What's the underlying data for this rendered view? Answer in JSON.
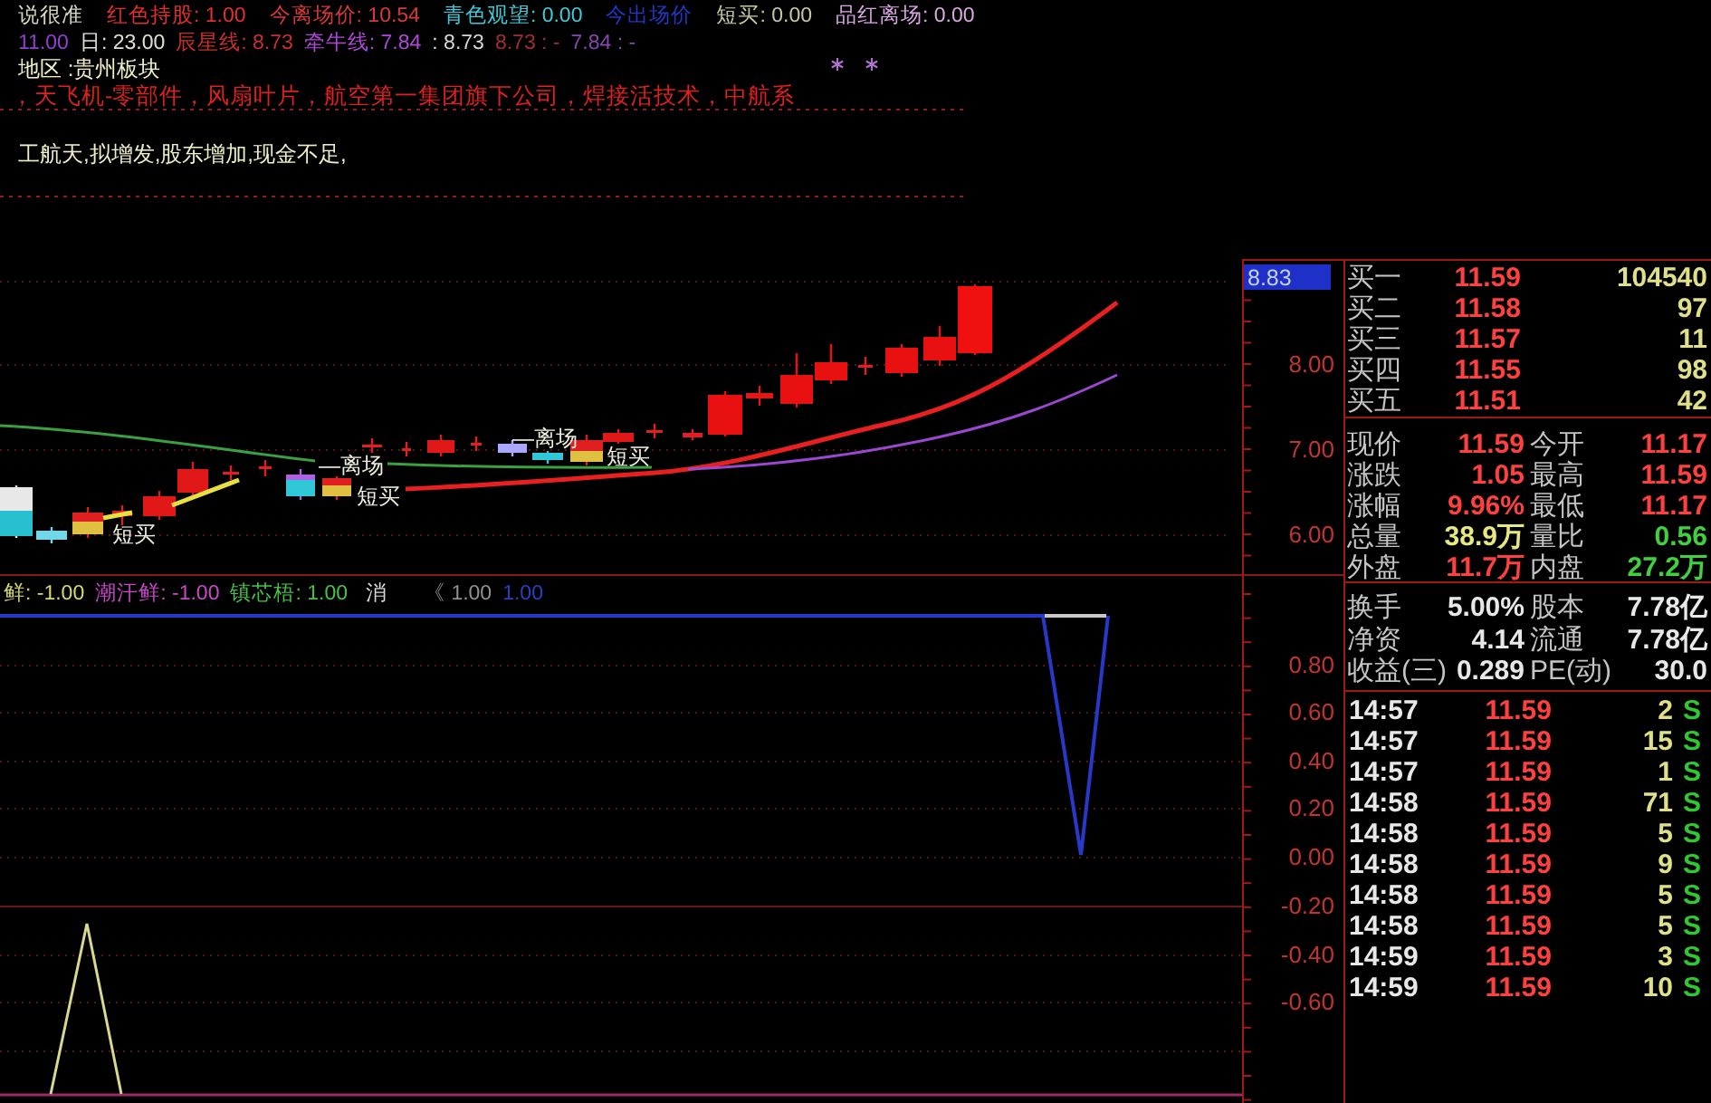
{
  "price_panel": {
    "formula_name": {
      "text": "说很准",
      "color": "#d8d8c0"
    },
    "readings": [
      {
        "text": "红色持股: 1.00",
        "color": "#e03030"
      },
      {
        "text": "今离场价: 10.54",
        "color": "#d83838"
      },
      {
        "text": "青色观望: 0.00",
        "color": "#40c8d8"
      },
      {
        "text": "今出场价",
        "color": "#2038c8"
      },
      {
        "text": "短买: 0.00",
        "color": "#c8c8a0"
      },
      {
        "text": "品红离场: 0.00",
        "color": "#d8a8e0"
      }
    ],
    "ma_readings": [
      {
        "text": "11.00",
        "color": "#9040d0"
      },
      {
        "text": "日: 23.00",
        "color": "#e0e0d0"
      },
      {
        "text": "辰星线: 8.73",
        "color": "#c83030"
      },
      {
        "text": "牵牛线: 7.84",
        "color": "#b048d8"
      },
      {
        "text": ": 8.73",
        "color": "#d8d8d8"
      },
      {
        "text": "8.73 : -",
        "color": "#a03030"
      },
      {
        "text": "7.84 : -",
        "color": "#8848b0"
      }
    ],
    "sector": "地区 :贵州板块",
    "concepts": "，天飞机-零部件，风扇叶片，航空第一集团旗下公司，焊接活技术，中航系",
    "note": "工航天,拟增发,股东增加,现金不足,",
    "price_marker": "8.83",
    "axis_labels": [
      "8.00",
      "7.00",
      "6.00"
    ],
    "signals": [
      "短买",
      "—离场",
      "短买",
      "—离场",
      "短买"
    ]
  },
  "indicator_panel": {
    "readings": [
      {
        "text": "鲜: -1.00",
        "color": "#d8d870"
      },
      {
        "text": "潮汗鲜: -1.00",
        "color": "#c848c8"
      },
      {
        "text": "镇芯梧: 1.00",
        "color": "#48c048"
      },
      {
        "text": "消",
        "color": "#d8d8d8"
      },
      {
        "text": "《 1.00",
        "color": "#909090"
      },
      {
        "text": "1.00",
        "color": "#2a40c0"
      }
    ],
    "axis_labels": [
      "0.80",
      "0.60",
      "0.40",
      "0.20",
      "0.00",
      "-0.20",
      "-0.40",
      "-0.60"
    ]
  },
  "quote_panel": {
    "order_book": [
      {
        "label": "买一",
        "price": "11.59",
        "volume": "104540"
      },
      {
        "label": "买二",
        "price": "11.58",
        "volume": "97"
      },
      {
        "label": "买三",
        "price": "11.57",
        "volume": "11"
      },
      {
        "label": "买四",
        "price": "11.55",
        "volume": "98"
      },
      {
        "label": "买五",
        "price": "11.51",
        "volume": "42"
      }
    ],
    "quotes": [
      {
        "cells": [
          {
            "label": "现价",
            "value": "11.59",
            "color": "#ff4040"
          },
          {
            "label": "今开",
            "value": "11.17",
            "color": "#ff4040"
          }
        ]
      },
      {
        "cells": [
          {
            "label": "涨跌",
            "value": "1.05",
            "color": "#ff4040"
          },
          {
            "label": "最高",
            "value": "11.59",
            "color": "#ff4040"
          }
        ]
      },
      {
        "cells": [
          {
            "label": "涨幅",
            "value": "9.96%",
            "color": "#ff4040"
          },
          {
            "label": "最低",
            "value": "11.17",
            "color": "#ff4040"
          }
        ]
      },
      {
        "cells": [
          {
            "label": "总量",
            "value": "38.9万",
            "color": "#e8e880"
          },
          {
            "label": "量比",
            "value": "0.56",
            "color": "#40d040"
          }
        ]
      },
      {
        "cells": [
          {
            "label": "外盘",
            "value": "11.7万",
            "color": "#ff4040"
          },
          {
            "label": "内盘",
            "value": "27.2万",
            "color": "#40d040"
          }
        ]
      }
    ],
    "fundamentals": [
      {
        "cells": [
          {
            "label": "换手",
            "value": "5.00%"
          },
          {
            "label": "股本",
            "value": "7.78亿"
          }
        ]
      },
      {
        "cells": [
          {
            "label": "净资",
            "value": "4.14"
          },
          {
            "label": "流通",
            "value": "7.78亿"
          }
        ]
      },
      {
        "cells": [
          {
            "label": "收益(三)",
            "value": "0.289"
          },
          {
            "label": "PE(动)",
            "value": "30.0"
          }
        ]
      }
    ],
    "ticks": [
      {
        "time": "14:57",
        "price": "11.59",
        "volume": "2",
        "side": "S"
      },
      {
        "time": "14:57",
        "price": "11.59",
        "volume": "15",
        "side": "S"
      },
      {
        "time": "14:57",
        "price": "11.59",
        "volume": "1",
        "side": "S"
      },
      {
        "time": "14:58",
        "price": "11.59",
        "volume": "71",
        "side": "S"
      },
      {
        "time": "14:58",
        "price": "11.59",
        "volume": "5",
        "side": "S"
      },
      {
        "time": "14:58",
        "price": "11.59",
        "volume": "9",
        "side": "S"
      },
      {
        "time": "14:58",
        "price": "11.59",
        "volume": "5",
        "side": "S"
      },
      {
        "time": "14:58",
        "price": "11.59",
        "volume": "5",
        "side": "S"
      },
      {
        "time": "14:59",
        "price": "11.59",
        "volume": "3",
        "side": "S"
      },
      {
        "time": "14:59",
        "price": "11.59",
        "volume": "10",
        "side": "S"
      }
    ]
  }
}
